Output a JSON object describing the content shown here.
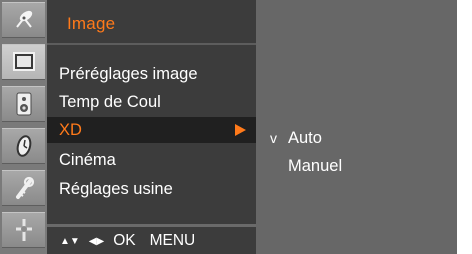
{
  "sidebar": {
    "icons": [
      {
        "name": "satellite-dish-icon"
      },
      {
        "name": "picture-icon",
        "active": true
      },
      {
        "name": "speaker-icon"
      },
      {
        "name": "clock-icon"
      },
      {
        "name": "lock-key-icon"
      },
      {
        "name": "option-tools-icon"
      }
    ]
  },
  "menu": {
    "title": "Image",
    "items": [
      {
        "label": "Préréglages image"
      },
      {
        "label": "Temp de Coul"
      },
      {
        "label": "XD",
        "selected": true
      },
      {
        "label": "Cinéma"
      },
      {
        "label": "Réglages usine"
      }
    ]
  },
  "submenu": {
    "items": [
      {
        "label": "Auto",
        "checked": true,
        "check_mark": "v"
      },
      {
        "label": "Manuel",
        "checked": false,
        "check_mark": ""
      }
    ]
  },
  "footer": {
    "updown_glyph": "▲▼",
    "leftright_glyph": "◀▶",
    "ok_label": "OK",
    "menu_label": "MENU"
  },
  "colors": {
    "accent": "#ff7a1a",
    "menu_bg": "#3c3c3c",
    "selected_bg": "#202020",
    "screen_bg": "#676767"
  }
}
